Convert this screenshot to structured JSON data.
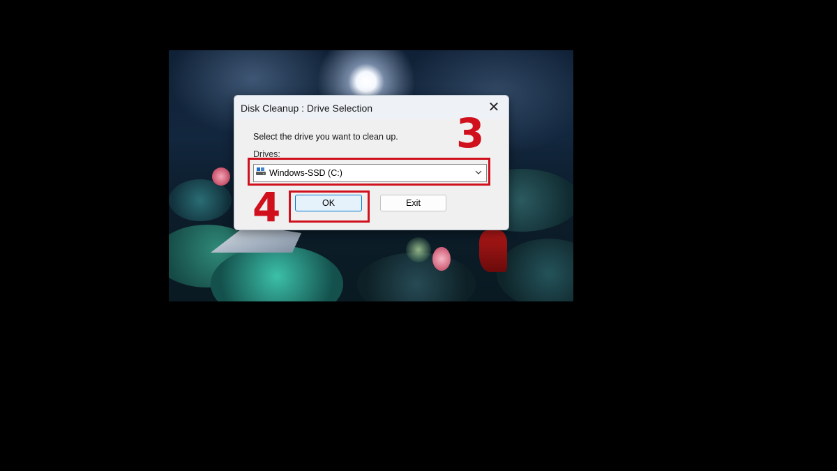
{
  "dialog": {
    "title": "Disk Cleanup : Drive Selection",
    "close_glyph": "✕",
    "prompt": "Select the drive you want to clean up.",
    "drives_label": "Drives:",
    "selected_drive": "Windows-SSD (C:)",
    "drive_icon": "drive-icon",
    "ok_label": "OK",
    "exit_label": "Exit"
  },
  "annotations": {
    "step_3": "3",
    "step_4": "4",
    "color": "#d0101c"
  }
}
